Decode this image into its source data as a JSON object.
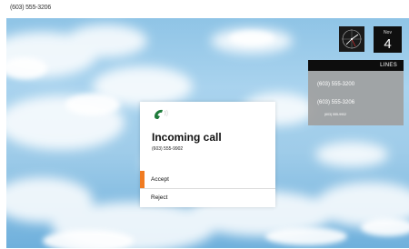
{
  "topbar": {
    "phone_number": "(603) 555-3206"
  },
  "clock": {
    "icon": "analog-clock-icon"
  },
  "date": {
    "month": "Nov",
    "day": "4"
  },
  "lines": {
    "header": "LINES",
    "items": [
      "(603) 555-3200",
      "(603) 555-3206",
      "(603) 555-9902"
    ]
  },
  "dialog": {
    "icon": "incoming-phone-icon",
    "title": "Incoming call",
    "caller": "(603) 555-9902",
    "accept_label": "Accept",
    "reject_label": "Reject"
  },
  "colors": {
    "accent": "#f07b22",
    "phone_icon": "#1e7a3a",
    "panel": "#0d0d0d"
  }
}
